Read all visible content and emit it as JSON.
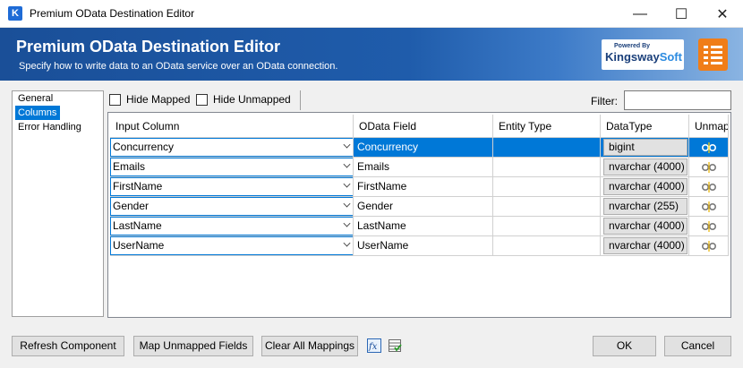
{
  "window": {
    "title": "Premium OData Destination Editor",
    "icon_letter": "K"
  },
  "controls": {
    "minimize": "—",
    "maximize": "☐",
    "close": "✕"
  },
  "banner": {
    "title": "Premium OData Destination Editor",
    "subtitle": "Specify how to write data to an OData service over an OData connection.",
    "brand_tagline": "Powered By",
    "brand_first": "K",
    "brand_mid": "ingsway",
    "brand_last": "Soft"
  },
  "nav": {
    "items": [
      {
        "label": "General"
      },
      {
        "label": "Columns"
      },
      {
        "label": "Error Handling"
      }
    ],
    "selected": "Columns"
  },
  "toolbar": {
    "hide_mapped": "Hide Mapped",
    "hide_unmapped": "Hide Unmapped",
    "filter_label": "Filter:",
    "filter_value": ""
  },
  "grid": {
    "headers": {
      "input_column": "Input Column",
      "odata_field": "OData Field",
      "entity_type": "Entity Type",
      "datatype": "DataType",
      "unmap": "Unmap"
    },
    "rows": [
      {
        "input": "Concurrency",
        "field": "Concurrency",
        "entity": "",
        "dtype": "bigint"
      },
      {
        "input": "Emails",
        "field": "Emails",
        "entity": "",
        "dtype": "nvarchar (4000)"
      },
      {
        "input": "FirstName",
        "field": "FirstName",
        "entity": "",
        "dtype": "nvarchar (4000)"
      },
      {
        "input": "Gender",
        "field": "Gender",
        "entity": "",
        "dtype": "nvarchar (255)"
      },
      {
        "input": "LastName",
        "field": "LastName",
        "entity": "",
        "dtype": "nvarchar (4000)"
      },
      {
        "input": "UserName",
        "field": "UserName",
        "entity": "",
        "dtype": "nvarchar (4000)"
      }
    ]
  },
  "buttons": {
    "refresh": "Refresh Component",
    "map_unmapped": "Map Unmapped Fields",
    "clear_all": "Clear All Mappings",
    "ok": "OK",
    "cancel": "Cancel"
  },
  "colors": {
    "accent": "#0078d7",
    "banner": "#1f5cab",
    "brand_orange": "#f07d18"
  }
}
